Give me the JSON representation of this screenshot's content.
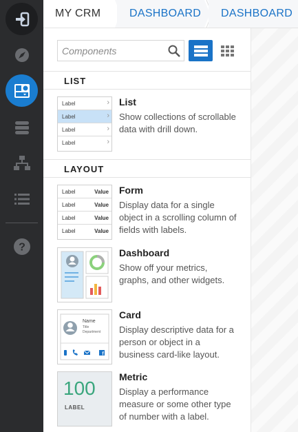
{
  "rail": {
    "items": [
      {
        "name": "exit-icon"
      },
      {
        "name": "compass-icon"
      },
      {
        "name": "components-icon"
      },
      {
        "name": "database-icon"
      },
      {
        "name": "hierarchy-icon"
      },
      {
        "name": "list-icon"
      },
      {
        "name": "help-icon"
      }
    ],
    "active": "components-icon"
  },
  "header": {
    "app_title": "MY CRM",
    "breadcrumbs": [
      "DASHBOARD",
      "DASHBOARD"
    ]
  },
  "panel": {
    "search": {
      "placeholder": "Components",
      "value": ""
    },
    "view_modes": [
      "list-view",
      "grid-view"
    ],
    "active_view": "list-view",
    "sections": [
      {
        "title": "LIST"
      },
      {
        "title": "LAYOUT"
      }
    ],
    "components": {
      "list": {
        "title": "List",
        "description": "Show collections of scrollable data with drill down.",
        "thumb_rows": [
          "Label",
          "Label",
          "Label",
          "Label"
        ]
      },
      "form": {
        "title": "Form",
        "description": "Display data for a single object in a scrolling column of fields with labels.",
        "thumb_label": "Label",
        "thumb_value": "Value"
      },
      "dashboard": {
        "title": "Dashboard",
        "description": "Show off your metrics, graphs, and other widgets."
      },
      "card": {
        "title": "Card",
        "description": "Display descriptive data for a person or object in a business card-like layout.",
        "thumb_lines": [
          "Name",
          "Title",
          "Department"
        ]
      },
      "metric": {
        "title": "Metric",
        "description": "Display a performance measure or some other type of number with a label.",
        "thumb_number": "100",
        "thumb_label": "LABEL"
      }
    }
  },
  "colors": {
    "accent": "#1a7dd0",
    "rail_bg": "#2b2c2e",
    "link": "#1a73c7",
    "metric_green": "#3aa67d"
  }
}
